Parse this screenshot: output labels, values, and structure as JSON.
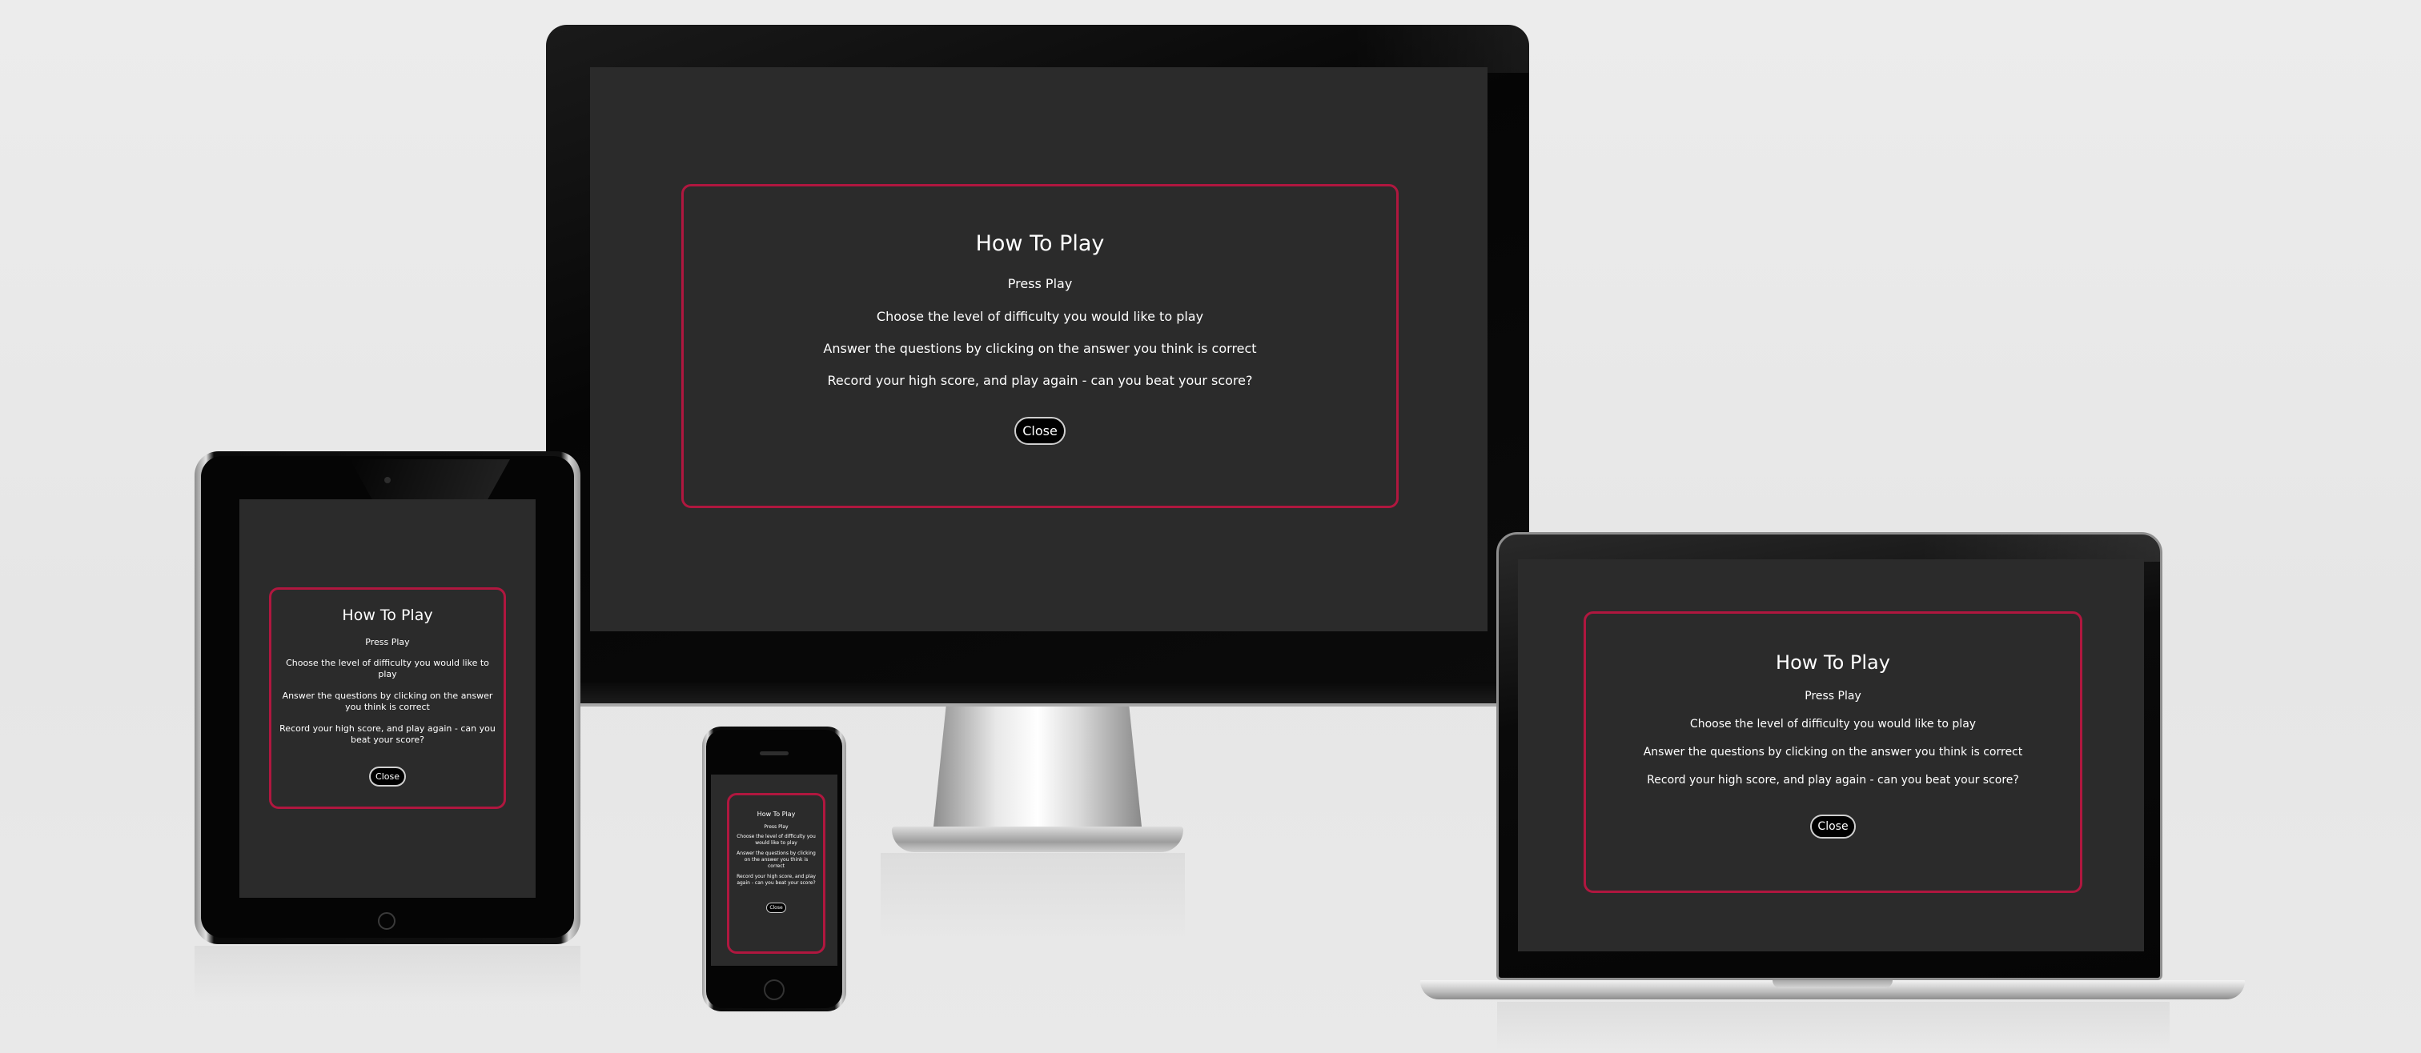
{
  "modal": {
    "title": "How To Play",
    "lines": [
      "Press Play",
      "Choose the level of difficulty you would like to play",
      "Answer the questions by clicking on the answer you think is correct",
      "Record your high score, and play again - can you beat your score?"
    ],
    "close_label": "Close"
  },
  "colors": {
    "page_background": "#e8e8e8",
    "screen_background": "#2b2b2b",
    "modal_border": "#b0173f",
    "text": "#ffffff",
    "button_background": "#000000"
  }
}
